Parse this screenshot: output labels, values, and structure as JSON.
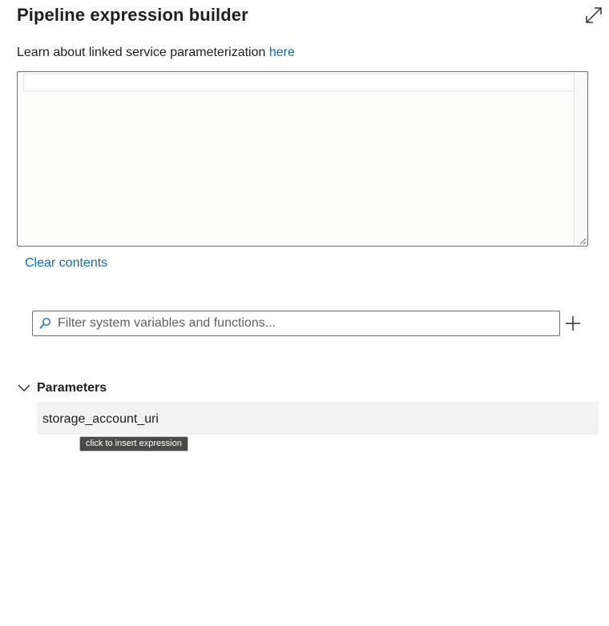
{
  "header": {
    "title": "Pipeline expression builder",
    "expand_icon": "expand-diagonal-icon"
  },
  "info": {
    "text": "Learn about linked service parameterization ",
    "link_label": "here"
  },
  "editor": {
    "value": ""
  },
  "clear_label": "Clear contents",
  "filter": {
    "placeholder": "Filter system variables and functions...",
    "value": "",
    "icon": "search-icon",
    "add_icon": "plus-icon"
  },
  "parameters": {
    "header": "Parameters",
    "expanded": true,
    "items": [
      {
        "name": "storage_account_uri"
      }
    ]
  },
  "tooltip": "click to insert expression",
  "colors": {
    "link": "#0f6cbd",
    "row_bg": "#f2f2f2",
    "tooltip_bg": "#4a4a48"
  }
}
